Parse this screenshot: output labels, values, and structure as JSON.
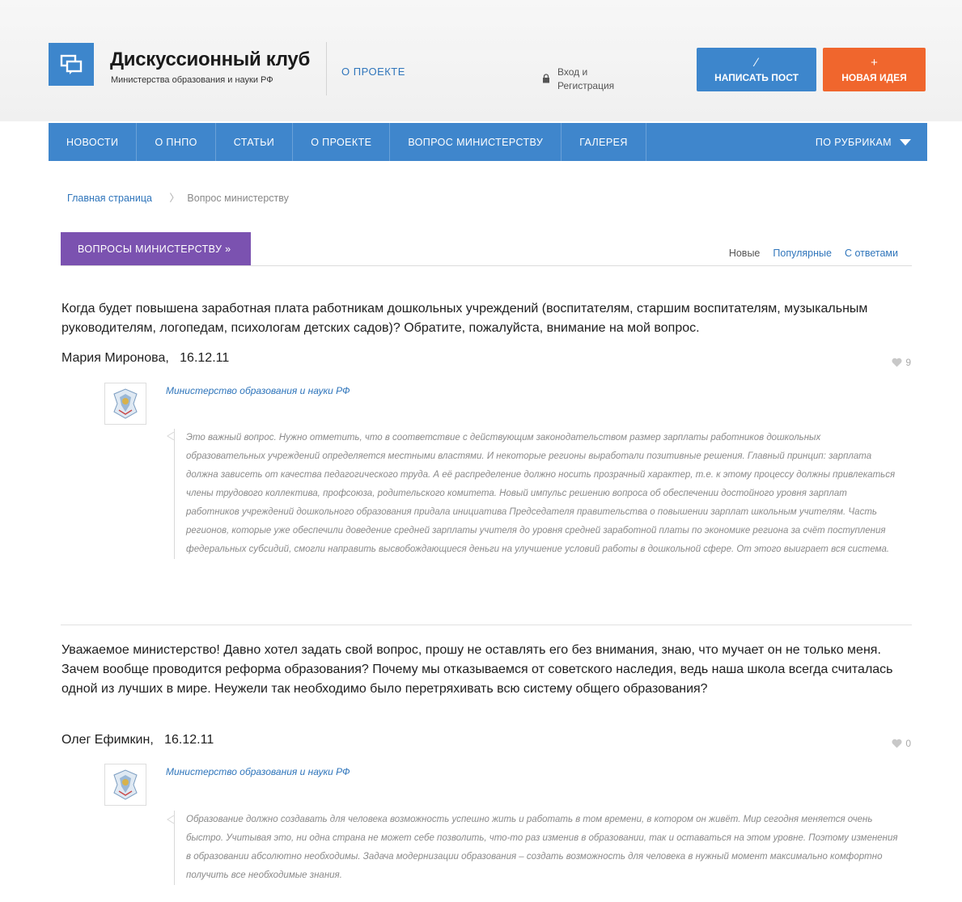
{
  "header": {
    "title": "Дискуссионный клуб",
    "subtitle": "Министерства образования и науки РФ",
    "about_link": "О ПРОЕКТЕ",
    "login_line1": "Вход и",
    "login_line2": "Регистрация",
    "write_post_label": "НАПИСАТЬ ПОСТ",
    "write_post_glyph": "∕",
    "new_idea_label": "НОВАЯ ИДЕЯ",
    "new_idea_glyph": "+",
    "brand_color": "#3d86cc",
    "accent_color": "#f0662d"
  },
  "nav": {
    "items": [
      "НОВОСТИ",
      "О ПНПО",
      "СТАТЬИ",
      "О ПРОЕКТЕ",
      "ВОПРОС МИНИСТЕРСТВУ",
      "ГАЛЕРЕЯ"
    ],
    "rubrics_label": "ПО РУБРИКАМ"
  },
  "breadcrumb": {
    "home": "Главная страница",
    "separator": "〉",
    "current": "Вопрос министерству"
  },
  "section": {
    "badge": "ВОПРОСЫ МИНИСТЕРСТВУ »",
    "badge_color": "#7b52b0",
    "tabs": [
      "Новые",
      "Популярные",
      "С ответами"
    ],
    "active_tab": "Новые"
  },
  "questions": [
    {
      "text": "Когда будет повышена заработная плата работникам дошкольных учреждений (воспитателям, старшим воспитателям, музыкальным руководителям, логопедам, психологам детских садов)? Обратите, пожалуйста, внимание на мой вопрос.",
      "author": "Мария Миронова,",
      "date": "16.12.11",
      "likes": "9",
      "answer_author": "Министерство образования и науки РФ",
      "answer": "Это важный вопрос. Нужно отметить, что в соответствие с действующим законодательством размер зарплаты работников дошкольных образовательных учреждений определяется местными властями. И некоторые регионы выработали позитивные решения. Главный принцип: зарплата должна зависеть от качества педагогического труда. А её распределение должно носить прозрачный характер, т.е. к этому процессу должны привлекаться члены трудового коллектива, профсоюза, родительского комитета. Новый импульс решению вопроса об обеспечении достойного уровня зарплат работников учреждений дошкольного образования придала инициатива Председателя правительства о повышении зарплат школьным учителям. Часть регионов, которые уже обеспечили доведение средней зарплаты учителя до уровня средней заработной платы по экономике региона за счёт поступления федеральных субсидий, смогли направить высвобождающиеся деньги на улучшение условий работы в дошкольной сфере. От этого выиграет вся система."
    },
    {
      "text": "Уважаемое министерство! Давно хотел задать свой вопрос, прошу не оставлять его без внимания, знаю, что мучает он не только меня. Зачем вообще проводится реформа образования? Почему мы отказываемся от советского наследия, ведь наша школа всегда считалась одной из лучших в мире. Неужели так необходимо было перетряхивать всю систему общего образования?",
      "author": "Олег Ефимкин,",
      "date": "16.12.11",
      "likes": "0",
      "answer_author": "Министерство образования и науки РФ",
      "answer": "Образование должно создавать для человека возможность успешно жить и работать в том времени, в котором он живёт. Мир сегодня меняется очень быстро. Учитывая это, ни одна страна не может себе позволить, что-то раз изменив в образовании, так и оставаться на этом уровне. Поэтому изменения в образовании абсолютно необходимы. Задача модернизации образования – создать возможность для человека в нужный момент максимально комфортно получить все необходимые знания."
    }
  ]
}
